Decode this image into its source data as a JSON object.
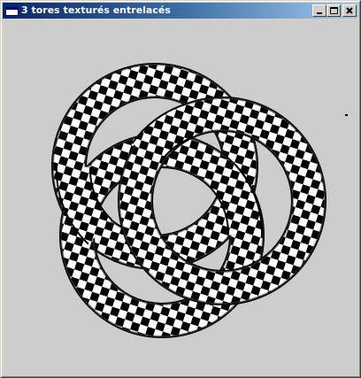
{
  "window": {
    "title": "3 tores texturés entrelacés",
    "icon": "app-window-icon",
    "controls": {
      "minimize": "minimize-icon",
      "maximize": "maximize-icon",
      "close": "close-icon"
    }
  },
  "scene": {
    "background": "#cdcdcd",
    "objects": [
      {
        "name": "torus",
        "texture": "checkerboard",
        "colors": [
          "#000000",
          "#ffffff"
        ]
      },
      {
        "name": "torus",
        "texture": "checkerboard",
        "colors": [
          "#000000",
          "#ffffff"
        ]
      },
      {
        "name": "torus",
        "texture": "checkerboard",
        "colors": [
          "#000000",
          "#ffffff"
        ]
      }
    ]
  }
}
